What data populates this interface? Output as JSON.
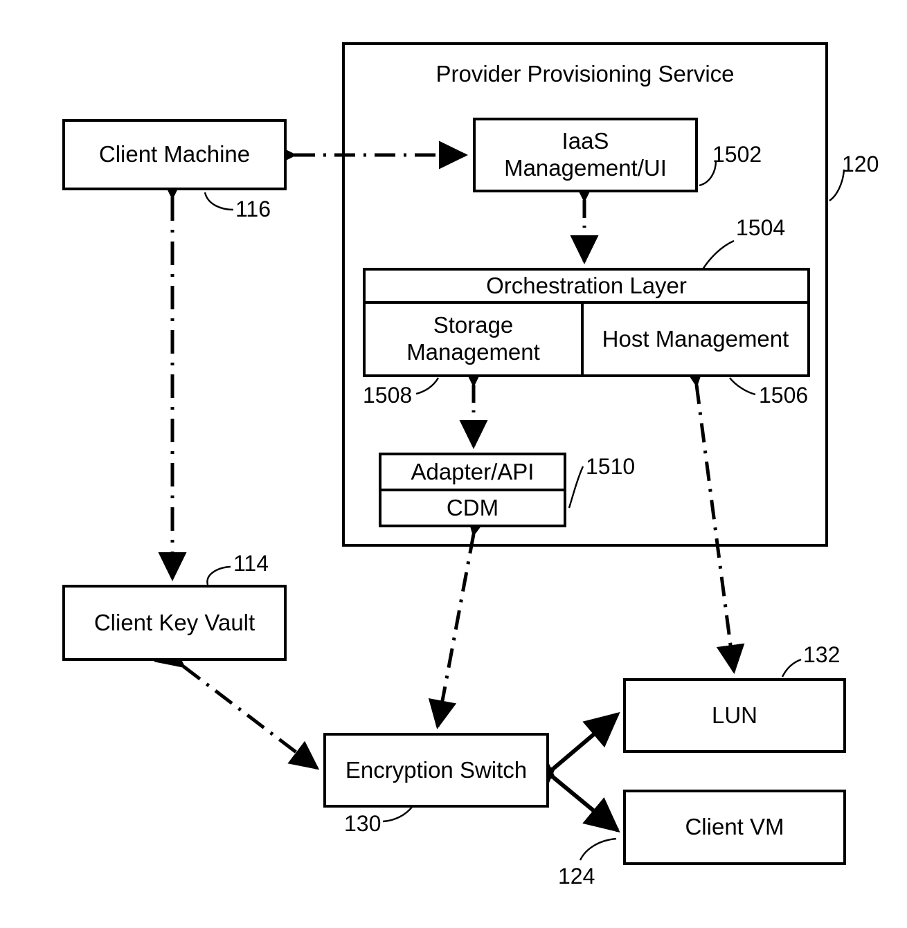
{
  "figure": {
    "type": "patent-block-diagram",
    "background": "#ffffff",
    "stroke": "#000000"
  },
  "container": {
    "title": "Provider Provisioning Service",
    "ref": "120"
  },
  "nodes": {
    "client_machine": {
      "label": "Client Machine",
      "ref": "116"
    },
    "client_key_vault": {
      "label": "Client Key Vault",
      "ref": "114"
    },
    "iaas": {
      "label_line1": "IaaS",
      "label_line2": "Management/UI",
      "ref": "1502"
    },
    "orchestration": {
      "header": "Orchestration Layer",
      "ref": "1504",
      "storage_line1": "Storage",
      "storage_line2": "Management",
      "storage_ref": "1508",
      "host": "Host Management",
      "host_ref": "1506"
    },
    "adapter": {
      "header": "Adapter/API",
      "body": "CDM",
      "ref": "1510"
    },
    "encryption_switch": {
      "label": "Encryption Switch",
      "ref": "130"
    },
    "lun": {
      "label": "LUN",
      "ref": "132"
    },
    "client_vm": {
      "label": "Client VM",
      "ref": "124"
    }
  },
  "connections": [
    {
      "name": "client-machine-to-iaas",
      "style": "dash-dot",
      "arrows": "both"
    },
    {
      "name": "iaas-to-orchestration",
      "style": "dash-dot",
      "arrows": "both"
    },
    {
      "name": "storage-management-to-adapter",
      "style": "dash-dot",
      "arrows": "both"
    },
    {
      "name": "adapter-to-encryption-switch",
      "style": "dash-dot",
      "arrows": "both"
    },
    {
      "name": "host-management-to-lun",
      "style": "dash-dot",
      "arrows": "both"
    },
    {
      "name": "client-machine-to-client-key-vault",
      "style": "dash-dot",
      "arrows": "both"
    },
    {
      "name": "client-key-vault-to-encryption-switch",
      "style": "dash-dot",
      "arrows": "both"
    },
    {
      "name": "encryption-switch-to-lun",
      "style": "solid",
      "arrows": "both"
    },
    {
      "name": "encryption-switch-to-client-vm",
      "style": "solid",
      "arrows": "both"
    }
  ]
}
